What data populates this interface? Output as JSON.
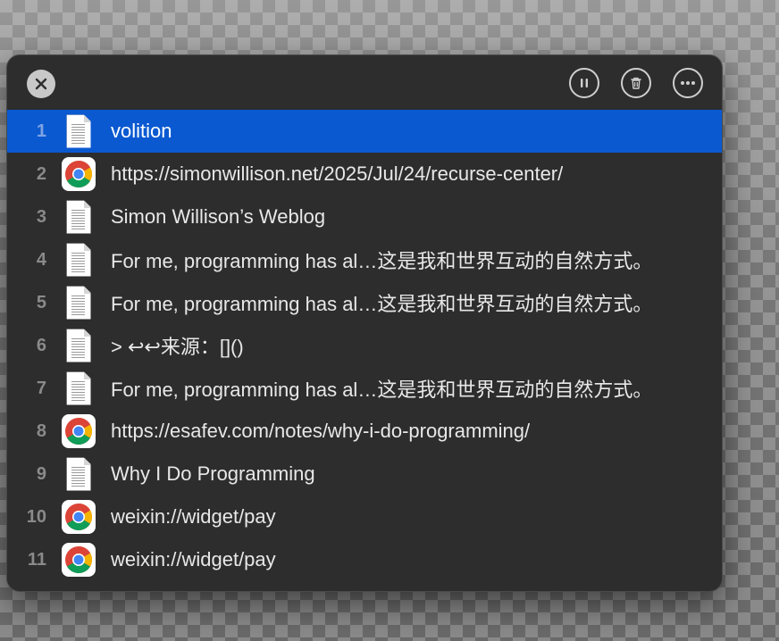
{
  "toolbar": {
    "close_icon": "close-icon",
    "pause_icon": "pause-icon",
    "trash_icon": "trash-icon",
    "more_icon": "more-icon"
  },
  "colors": {
    "selection": "#0a59d1",
    "panel": "#2d2d2d"
  },
  "items": [
    {
      "index": "1",
      "icon": "document-icon",
      "text": "volition",
      "selected": true
    },
    {
      "index": "2",
      "icon": "chrome-icon",
      "text": "https://simonwillison.net/2025/Jul/24/recurse-center/"
    },
    {
      "index": "3",
      "icon": "document-icon",
      "text": "Simon Willison’s Weblog"
    },
    {
      "index": "4",
      "icon": "document-icon",
      "text": "For me, programming has al…这是我和世界互动的自然方式。"
    },
    {
      "index": "5",
      "icon": "document-icon",
      "text": "For me, programming has al…这是我和世界互动的自然方式。"
    },
    {
      "index": "6",
      "icon": "document-icon",
      "text": "> ↩↩来源：[]()"
    },
    {
      "index": "7",
      "icon": "document-icon",
      "text": "For me, programming has al…这是我和世界互动的自然方式。"
    },
    {
      "index": "8",
      "icon": "chrome-icon",
      "text": "https://esafev.com/notes/why-i-do-programming/"
    },
    {
      "index": "9",
      "icon": "document-icon",
      "text": "Why I Do Programming"
    },
    {
      "index": "10",
      "icon": "chrome-icon",
      "text": "weixin://widget/pay"
    },
    {
      "index": "11",
      "icon": "chrome-icon",
      "text": "weixin://widget/pay"
    }
  ]
}
